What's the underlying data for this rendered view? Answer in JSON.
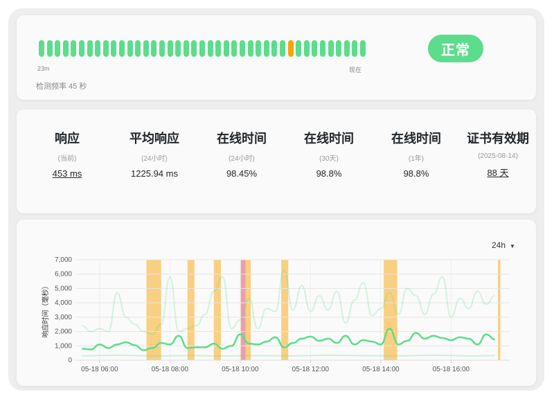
{
  "heartbeat": {
    "beats": [
      "up",
      "up",
      "up",
      "up",
      "up",
      "up",
      "up",
      "up",
      "up",
      "up",
      "up",
      "up",
      "up",
      "up",
      "up",
      "up",
      "up",
      "up",
      "up",
      "up",
      "up",
      "up",
      "up",
      "up",
      "up",
      "up",
      "up",
      "up",
      "up",
      "up",
      "up",
      "warn",
      "up",
      "up",
      "up",
      "up",
      "up",
      "up",
      "up",
      "up",
      "up"
    ],
    "left_label": "23m",
    "right_label": "现在",
    "frequency": "检测频率 45 秒",
    "status": "正常"
  },
  "colors": {
    "up": "#5cdd8b",
    "warn": "#f8a306",
    "down": "#dc3545",
    "maintenance_band": "#f8c76b",
    "down_band": "#ea8d97"
  },
  "stats": [
    {
      "title": "响应",
      "sub": "(当前)",
      "value": "453 ms",
      "link": true
    },
    {
      "title": "平均响应",
      "sub": "(24小时)",
      "value": "1225.94 ms",
      "link": false
    },
    {
      "title": "在线时间",
      "sub": "(24小时)",
      "value": "98.45%",
      "link": false
    },
    {
      "title": "在线时间",
      "sub": "(30天)",
      "value": "98.8%",
      "link": false
    },
    {
      "title": "在线时间",
      "sub": "(1年)",
      "value": "98.8%",
      "link": false
    },
    {
      "title": "证书有效期",
      "sub": "(2025-08-14)",
      "value": "88 天",
      "link": true
    }
  ],
  "chart_controls": {
    "range": "24h",
    "caret_icon": "chevron-down-icon"
  },
  "chart_data": {
    "type": "line",
    "ylabel": "响应时间（毫秒）",
    "ylim": [
      0,
      7000
    ],
    "yticks": [
      "0",
      "1,000",
      "2,000",
      "3,000",
      "4,000",
      "5,000",
      "6,000",
      "7,000"
    ],
    "xlim": [
      "05-18 05:20",
      "05-18 17:40"
    ],
    "xticks": [
      "05-18 06:00",
      "05-18 08:00",
      "05-18 10:00",
      "05-18 12:00",
      "05-18 14:00",
      "05-18 16:00"
    ],
    "grid": true,
    "series": [
      {
        "role": "average",
        "x": [
          "05:30",
          "05:45",
          "06:00",
          "06:15",
          "06:30",
          "06:45",
          "07:00",
          "07:15",
          "07:30",
          "07:45",
          "08:00",
          "08:15",
          "08:30",
          "08:45",
          "09:00",
          "09:15",
          "09:30",
          "09:45",
          "10:00",
          "10:15",
          "10:30",
          "10:45",
          "11:00",
          "11:15",
          "11:30",
          "11:45",
          "12:00",
          "12:15",
          "12:30",
          "12:45",
          "13:00",
          "13:15",
          "13:30",
          "13:45",
          "14:00",
          "14:15",
          "14:30",
          "14:45",
          "15:00",
          "15:15",
          "15:30",
          "15:45",
          "16:00",
          "16:15",
          "16:30",
          "16:45",
          "17:00",
          "17:15"
        ],
        "values": [
          800,
          750,
          1100,
          850,
          1100,
          1250,
          1050,
          700,
          850,
          1200,
          1100,
          1700,
          850,
          900,
          900,
          1150,
          800,
          1000,
          1800,
          1150,
          1100,
          1300,
          1600,
          900,
          1200,
          1500,
          1650,
          1350,
          1500,
          1200,
          1700,
          1100,
          1400,
          1300,
          1100,
          2200,
          1100,
          1350,
          1900,
          1500,
          1700,
          1550,
          1400,
          1600,
          1500,
          1100,
          1800,
          1450
        ]
      },
      {
        "role": "max",
        "x": [
          "05:30",
          "05:45",
          "06:00",
          "06:15",
          "06:30",
          "06:45",
          "07:00",
          "07:15",
          "07:30",
          "07:45",
          "08:00",
          "08:15",
          "08:30",
          "08:45",
          "09:00",
          "09:15",
          "09:30",
          "09:45",
          "10:00",
          "10:15",
          "10:30",
          "10:45",
          "11:00",
          "11:15",
          "11:30",
          "11:45",
          "12:00",
          "12:15",
          "12:30",
          "12:45",
          "13:00",
          "13:15",
          "13:30",
          "13:45",
          "14:00",
          "14:15",
          "14:30",
          "14:45",
          "15:00",
          "15:15",
          "15:30",
          "15:45",
          "16:00",
          "16:15",
          "16:30",
          "16:45",
          "17:00",
          "17:15"
        ],
        "values": [
          2400,
          2000,
          2200,
          2000,
          4700,
          3000,
          2500,
          2000,
          1800,
          2500,
          5800,
          2000,
          2200,
          2400,
          3200,
          4800,
          5800,
          2200,
          2800,
          4300,
          2200,
          3600,
          3400,
          6300,
          3500,
          5200,
          3400,
          4500,
          3500,
          4800,
          2600,
          4200,
          5400,
          3100,
          3600,
          4700,
          3200,
          5000,
          4500,
          3200,
          4600,
          5800,
          3000,
          4300,
          3600,
          4800,
          3900,
          4500
        ]
      },
      {
        "role": "min",
        "x": [
          "05:30",
          "06:30",
          "07:30",
          "08:30",
          "09:30",
          "10:30",
          "11:30",
          "12:30",
          "13:30",
          "14:30",
          "15:30",
          "16:30",
          "17:15"
        ],
        "values": [
          300,
          350,
          300,
          320,
          300,
          320,
          300,
          350,
          320,
          300,
          350,
          300,
          320
        ]
      }
    ],
    "bands": [
      {
        "kind": "maintenance",
        "from": "07:20",
        "to": "07:45"
      },
      {
        "kind": "maintenance",
        "from": "08:30",
        "to": "08:42"
      },
      {
        "kind": "maintenance",
        "from": "09:15",
        "to": "09:27"
      },
      {
        "kind": "down",
        "from": "10:01",
        "to": "10:09"
      },
      {
        "kind": "maintenance",
        "from": "10:09",
        "to": "10:18"
      },
      {
        "kind": "maintenance",
        "from": "11:10",
        "to": "11:22"
      },
      {
        "kind": "maintenance",
        "from": "14:05",
        "to": "14:28"
      },
      {
        "kind": "maintenance",
        "from": "17:20",
        "to": "17:24"
      }
    ]
  }
}
